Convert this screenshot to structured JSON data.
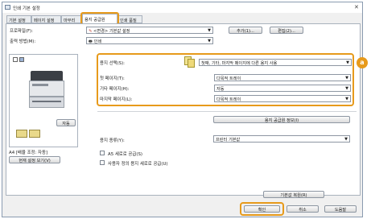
{
  "window": {
    "title": "인쇄 기본 설정",
    "close_glyph": "✕"
  },
  "tabs": [
    {
      "label": "기본 설정"
    },
    {
      "label": "페이지 설정"
    },
    {
      "label": "마무리"
    },
    {
      "label": "용지 공급원"
    },
    {
      "label": "인쇄 품질"
    }
  ],
  "profile": {
    "label": "프로파일(F):",
    "value": "<변경> 기본값 설정",
    "add_button": "추가(1)...",
    "edit_button": "편집(2)..."
  },
  "output": {
    "label": "출력 방법(M):",
    "value": "인쇄"
  },
  "paper_select": {
    "label": "용지 선택(S):",
    "value": "첫째, 기타, 마지막 페이지에 다른 용지 사용"
  },
  "first_page": {
    "label": "첫 페이지(T):",
    "value": "다목적 트레이"
  },
  "other_pages": {
    "label": "기타 페이지(H):",
    "value": "자동"
  },
  "last_page": {
    "label": "마지막 페이지(L):",
    "value": "다목적 트레이"
  },
  "paper_info_button": "용지 공급원 정보(I)",
  "paper_type": {
    "label": "용지 종류(Y):",
    "value": "프린터 기본값"
  },
  "a5_feed": {
    "label": "A5 세로로 공급(S)"
  },
  "user_paper": {
    "label": "사용자 정의 용지 세로로 공급(U)"
  },
  "preview": {
    "setting_button": "자동",
    "paper_caption": "A4 [배율 조정: 자동]",
    "view_button": "현재 설정 보기(V)"
  },
  "restore_button": "기본값 복원(R)",
  "footer": {
    "ok": "확인",
    "cancel": "취소",
    "help": "도움말"
  },
  "callout_label": "a"
}
